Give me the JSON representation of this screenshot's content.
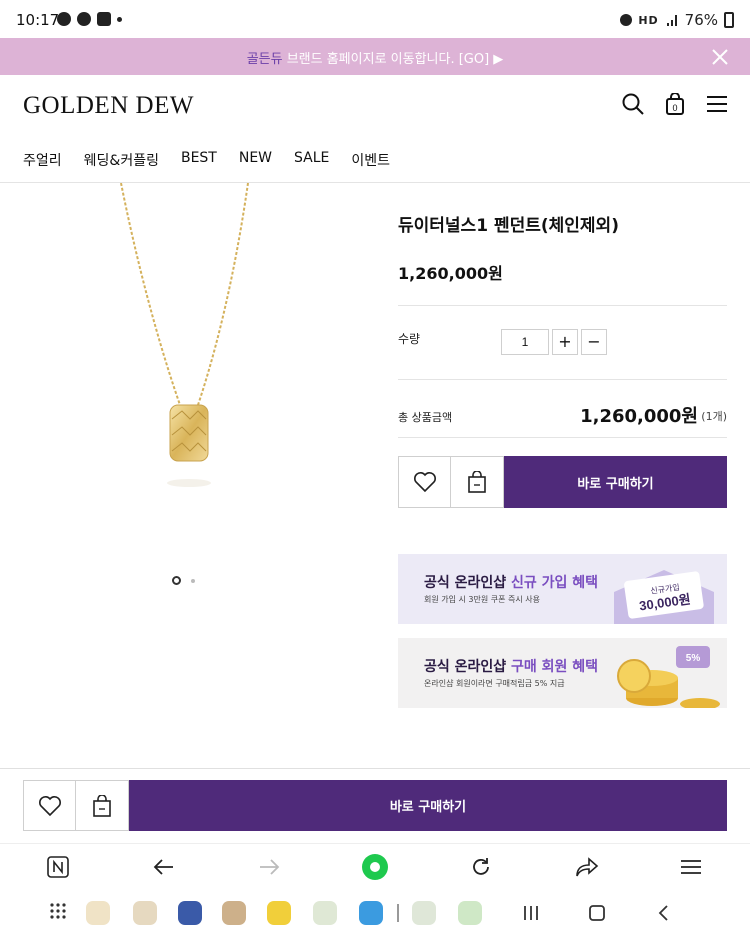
{
  "status_bar": {
    "time": "10:17",
    "battery": "76%",
    "network": "HD"
  },
  "promo": {
    "brand": "골든듀",
    "text": " 브랜드 홈페이지로 이동합니다. [GO] ▶"
  },
  "header": {
    "logo": "GOLDEN DEW"
  },
  "nav": [
    "주얼리",
    "웨딩&커플링",
    "BEST",
    "NEW",
    "SALE",
    "이벤트"
  ],
  "product": {
    "title": "듀이터널스1 펜던트(체인제외)",
    "price": "1,260,000원",
    "quantity_label": "수량",
    "quantity_value": "1",
    "plus": "+",
    "minus": "−",
    "total_label": "총 상품금액",
    "total_price": "1,260,000원",
    "total_count": "(1개)",
    "buy_now": "바로 구매하기"
  },
  "banners": [
    {
      "title_plain": "공식 온라인샵 ",
      "title_highlight": "신규 가입 혜택",
      "subtitle": "회원 가입 시 3만원 쿠폰 즉시 사용",
      "badge_top": "신규가입",
      "badge_amount": "30,000원"
    },
    {
      "title_plain": "공식 온라인샵 ",
      "title_highlight": "구매 회원 혜택",
      "subtitle": "온라인샵 회원이라면 구매적립금 5% 지급",
      "badge_top": "5%"
    }
  ],
  "sticky": {
    "buy_now": "바로 구매하기"
  },
  "colors": {
    "accent": "#4f2a7a",
    "promo": "#ddb3d6",
    "banner_bg": "#eceaf6"
  }
}
